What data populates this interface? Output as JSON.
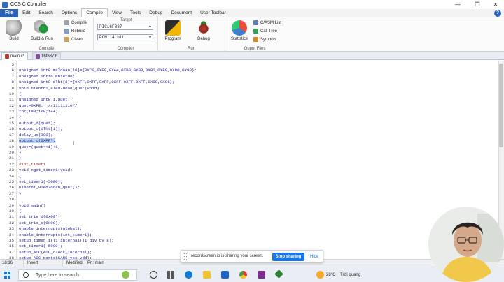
{
  "window": {
    "title": "CCS C Compiler"
  },
  "menu": {
    "file": "File",
    "items": [
      "Edit",
      "Search",
      "Options",
      "Compile",
      "View",
      "Tools",
      "Debug",
      "Document",
      "User Toolbar"
    ],
    "active": "Compile"
  },
  "ribbon": {
    "build": "Build",
    "build_run": "Build & Run",
    "compile": "Compile",
    "rebuild": "Rebuild",
    "clean": "Clean",
    "group_compile": "Compile",
    "target_label": "Target",
    "chip": "PIC16F887",
    "compiler": "PCM 14 bit",
    "group_compiler": "Compiler",
    "program": "Program",
    "debug": "Debug",
    "group_run": "Run",
    "statistics": "Statistics",
    "c_asm_list": "C/ASM List",
    "call_tree": "Call Tree",
    "symbols": "Symbols",
    "group_output": "Ouput Files"
  },
  "tabs": [
    {
      "label": "main.c*"
    },
    {
      "label": "16f887.h"
    }
  ],
  "code_lines": [
    {
      "n": "5",
      "t": ""
    },
    {
      "n": "6",
      "t": "unsigned int8 ma7doan[10]={0XC0,0XF9,0XA4,0XB0,0X99,0X92,0XF8,0X80,0X90};"
    },
    {
      "n": "7",
      "t": "unsigned int16 Nhietdo;"
    },
    {
      "n": "8",
      "t": "unsigned int8 dlht[8]={0XFF,0XFF,0XFF,0XFF,0XFF,0XFF,0X9C,0XC6};"
    },
    {
      "n": "9",
      "t": "void hienthi_8led7doan_quet(void)"
    },
    {
      "n": "10",
      "t": "{"
    },
    {
      "n": "11",
      "t": "unsigned int8 i,quet;"
    },
    {
      "n": "12",
      "t": "quet=0XFE;  //11111110//"
    },
    {
      "n": "13",
      "t": "for(i=0;i<8;i++)"
    },
    {
      "n": "14",
      "t": "{"
    },
    {
      "n": "15",
      "t": "output_d(quet);"
    },
    {
      "n": "16",
      "t": "output_c(dlht[i]);"
    },
    {
      "n": "17",
      "t": "delay_us(300);"
    },
    {
      "n": "18",
      "t": "output_c(0XFF);"
    },
    {
      "n": "19",
      "t": "quet=(quet<<1)+1;"
    },
    {
      "n": "20",
      "t": "}"
    },
    {
      "n": "21",
      "t": "}"
    },
    {
      "n": "22",
      "t": "#int_timer1"
    },
    {
      "n": "23",
      "t": "void ngat_timer1(void)"
    },
    {
      "n": "24",
      "t": "{"
    },
    {
      "n": "25",
      "t": "set_timer1(-5000);"
    },
    {
      "n": "26",
      "t": "hienthi_8led7doan_quet();"
    },
    {
      "n": "27",
      "t": "}"
    },
    {
      "n": "28",
      "t": ""
    },
    {
      "n": "29",
      "t": "void main()"
    },
    {
      "n": "30",
      "t": "{"
    },
    {
      "n": "31",
      "t": "set_tris_d(0x00);"
    },
    {
      "n": "32",
      "t": "set_tris_c(0x00);"
    },
    {
      "n": "33",
      "t": "enable_interrupts(global);"
    },
    {
      "n": "34",
      "t": "enable_interrupts(int_timer1);"
    },
    {
      "n": "35",
      "t": "setup_timer_1(T1_internal|T1_div_by_8);"
    },
    {
      "n": "36",
      "t": "set_timer1(-5000);"
    },
    {
      "n": "37",
      "t": "setup_ADC(ADC_clock_internal);"
    },
    {
      "n": "38",
      "t": "setup_ADC_ports(SAN5|vss_vdd);"
    }
  ],
  "highlighted_line": "18",
  "status": {
    "position": "18:16",
    "mode": "Insert",
    "modified": "Modified",
    "prj": "Prj: main"
  },
  "share": {
    "message": "recordscreen.io is sharing your screen.",
    "stop": "Stop sharing",
    "hide": "Hide"
  },
  "taskbar": {
    "search_placeholder": "Type here to search",
    "weather": "28°C",
    "weather_text": "Trời quang"
  },
  "colors": {
    "accent": "#2b62b8",
    "highlight": "#b7d1f2",
    "share_button": "#1a73e8"
  }
}
